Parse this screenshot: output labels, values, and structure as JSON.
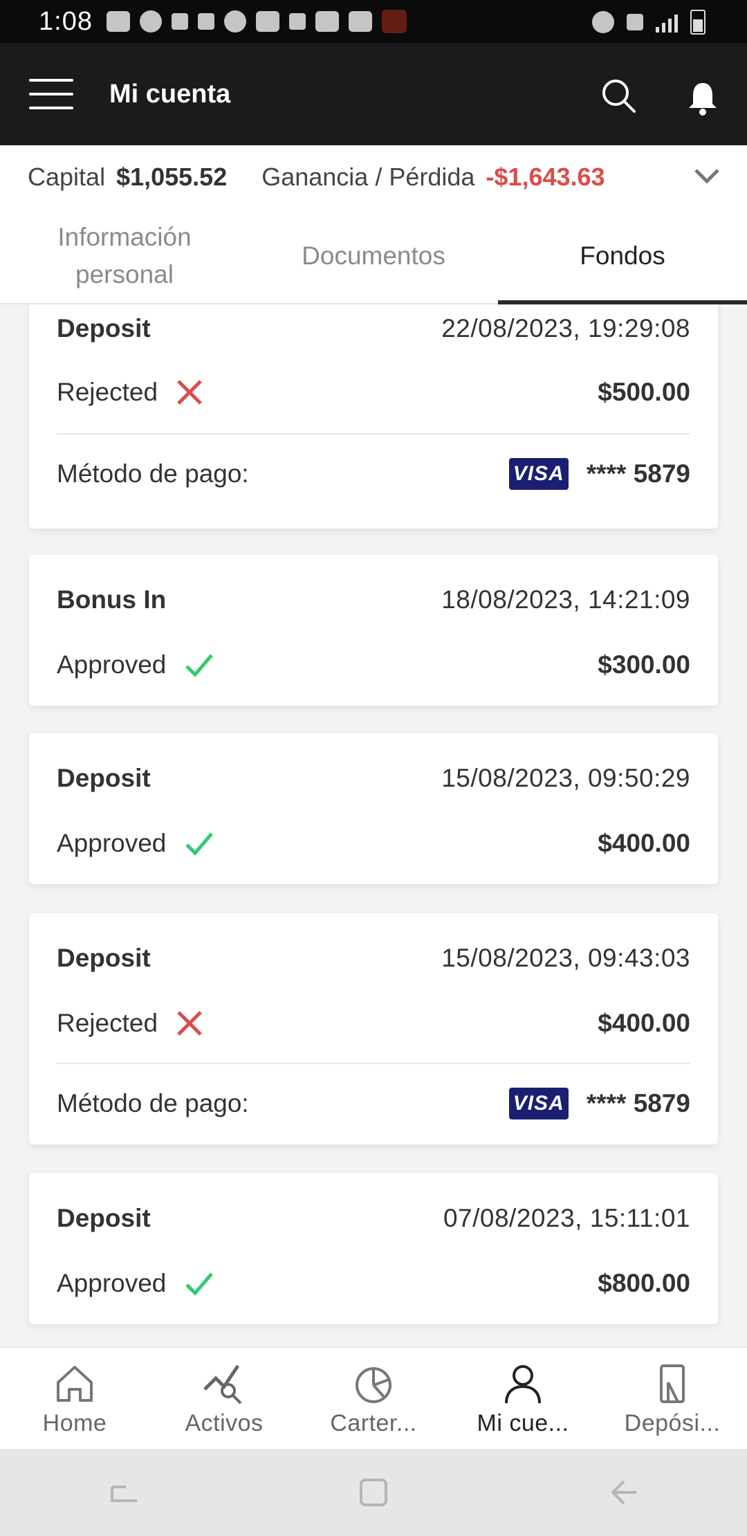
{
  "status_bar": {
    "time": "1:08"
  },
  "header": {
    "title": "Mi cuenta"
  },
  "summary": {
    "capital_label": "Capital",
    "capital_value": "$1,055.52",
    "pl_label": "Ganancia / Pérdida",
    "pl_value": "-$1,643.63",
    "pl_color": "#e04a4a"
  },
  "tabs": [
    {
      "label": "Información personal",
      "active": false
    },
    {
      "label": "Documentos",
      "active": false
    },
    {
      "label": "Fondos",
      "active": true
    }
  ],
  "transactions": [
    {
      "type": "Deposit",
      "date": "22/08/2023, 19:29:08",
      "status": "Rejected",
      "status_icon": "x-icon",
      "amount": "$500.00",
      "payment_label": "Método de pago:",
      "card_brand": "VISA",
      "card_number": "**** 5879"
    },
    {
      "type": "Bonus In",
      "date": "18/08/2023, 14:21:09",
      "status": "Approved",
      "status_icon": "check-icon",
      "amount": "$300.00"
    },
    {
      "type": "Deposit",
      "date": "15/08/2023, 09:50:29",
      "status": "Approved",
      "status_icon": "check-icon",
      "amount": "$400.00"
    },
    {
      "type": "Deposit",
      "date": "15/08/2023, 09:43:03",
      "status": "Rejected",
      "status_icon": "x-icon",
      "amount": "$400.00",
      "payment_label": "Método de pago:",
      "card_brand": "VISA",
      "card_number": "**** 5879"
    },
    {
      "type": "Deposit",
      "date": "07/08/2023, 15:11:01",
      "status": "Approved",
      "status_icon": "check-icon",
      "amount": "$800.00"
    }
  ],
  "bottom_nav": [
    {
      "label": "Home",
      "icon": "home-icon",
      "active": false
    },
    {
      "label": "Activos",
      "icon": "activos-icon",
      "active": false
    },
    {
      "label": "Carter...",
      "icon": "pie-chart-icon",
      "active": false
    },
    {
      "label": "Mi cue...",
      "icon": "user-icon",
      "active": true
    },
    {
      "label": "Depósi...",
      "icon": "deposit-icon",
      "active": false
    }
  ],
  "colors": {
    "approved": "#2ecc71",
    "rejected": "#e04a4a",
    "visa": "#1a1f71",
    "header_bg": "#1b1b1b"
  }
}
